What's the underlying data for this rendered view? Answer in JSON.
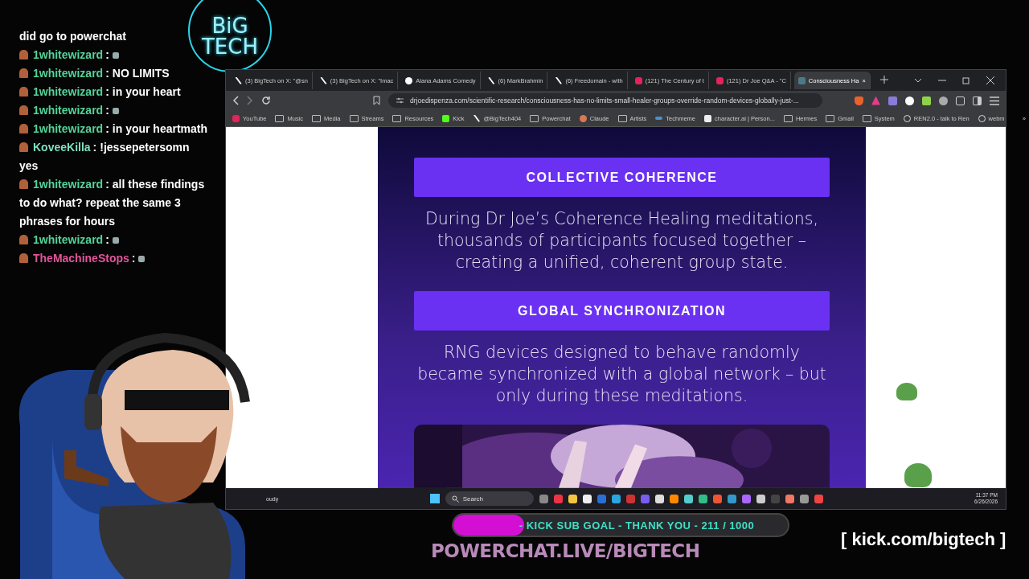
{
  "chat": [
    {
      "kind": "text",
      "text": "did go to powerchat"
    },
    {
      "kind": "emote",
      "user": "1whitewizard",
      "sep": ":",
      "color": "#53d39a"
    },
    {
      "kind": "text",
      "user": "1whitewizard",
      "sep": ":",
      "color": "#53d39a",
      "text": "NO LIMITS"
    },
    {
      "kind": "text",
      "user": "1whitewizard",
      "sep": ":",
      "color": "#53d39a",
      "text": "in your heart"
    },
    {
      "kind": "emote",
      "user": "1whitewizard",
      "sep": ":",
      "color": "#53d39a"
    },
    {
      "kind": "text",
      "user": "1whitewizard",
      "sep": ":",
      "color": "#53d39a",
      "text": "in your heartmath"
    },
    {
      "kind": "text",
      "user": "KoveeKilla",
      "sep": ":",
      "color": "#7fe0c0",
      "text": "!jessepetersomn yes"
    },
    {
      "kind": "text",
      "user": "1whitewizard",
      "sep": ":",
      "color": "#53d39a",
      "text": "all these findings to do what? repeat the same 3 phrases for hours"
    },
    {
      "kind": "emote",
      "user": "1whitewizard",
      "sep": ":",
      "color": "#53d39a"
    },
    {
      "kind": "emote",
      "user": "TheMachineStops",
      "sep": ":",
      "color": "#e0559a"
    }
  ],
  "logo": [
    "BiG",
    "TECH"
  ],
  "browser": {
    "tabs": [
      {
        "kind": "x",
        "label": "(3) BigTech on X: \"@sn",
        "selected": false
      },
      {
        "kind": "x",
        "label": "(3) BigTech on X: \"Imac",
        "selected": false
      },
      {
        "kind": "tiktok",
        "label": "Alana Adams Comedy",
        "selected": false
      },
      {
        "kind": "x",
        "label": "(6) MarkBrahmin",
        "selected": false
      },
      {
        "kind": "x",
        "label": "(6) Freedomain - with",
        "selected": false
      },
      {
        "kind": "youtube",
        "label": "(121) The Century of t",
        "selected": false
      },
      {
        "kind": "youtube",
        "label": "(121) Dr Joe Q&A - \"C",
        "selected": false
      },
      {
        "kind": "page",
        "label": "Consciousness Ha",
        "selected": true
      }
    ],
    "tab_close": "×",
    "url": "drjoedispenza.com/scientific-research/consciousness-has-no-limits-small-healer-groups-override-random-devices-globally-just-...",
    "bookmarks": [
      {
        "kind": "youtube",
        "label": "YouTube"
      },
      {
        "kind": "folder",
        "label": "Music"
      },
      {
        "kind": "folder",
        "label": "Media"
      },
      {
        "kind": "folder",
        "label": "Streams"
      },
      {
        "kind": "folder",
        "label": "Resources"
      },
      {
        "kind": "kick",
        "label": "Kick"
      },
      {
        "kind": "x",
        "label": "@BigTech404"
      },
      {
        "kind": "folder",
        "label": "Powerchat"
      },
      {
        "kind": "claude",
        "label": "Claude"
      },
      {
        "kind": "folder",
        "label": "Artists"
      },
      {
        "kind": "techmeme",
        "label": "Techmeme"
      },
      {
        "kind": "cai",
        "label": "character.ai | Person..."
      },
      {
        "kind": "folder",
        "label": "Hermes"
      },
      {
        "kind": "folder",
        "label": "Gmail"
      },
      {
        "kind": "folder",
        "label": "System"
      },
      {
        "kind": "globe",
        "label": "REN2.0 - talk to Ren"
      },
      {
        "kind": "globe",
        "label": "webm"
      }
    ],
    "more": "»",
    "page": [
      {
        "heading": "COLLECTIVE COHERENCE",
        "text": "During Dr Joe’s Coherence Healing meditations, thousands of participants focused together – creating a unified, coherent group state."
      },
      {
        "heading": "GLOBAL SYNCHRONIZATION",
        "text": "RNG devices designed to behave randomly became synchronized with a global network – but only during these meditations."
      }
    ]
  },
  "taskbar": {
    "weather": "oudy",
    "search": {
      "placeholder": "Search"
    },
    "time": "11:37 PM",
    "date": "6/26/2026"
  },
  "sub_goal": {
    "text": "- KICK SUB GOAL - THANK YOU - 211 / 1000",
    "level": 0.211
  },
  "banner": "POWERCHAT.LIVE/BIGTECH",
  "kick_url": "[ kick.com/bigtech ]"
}
